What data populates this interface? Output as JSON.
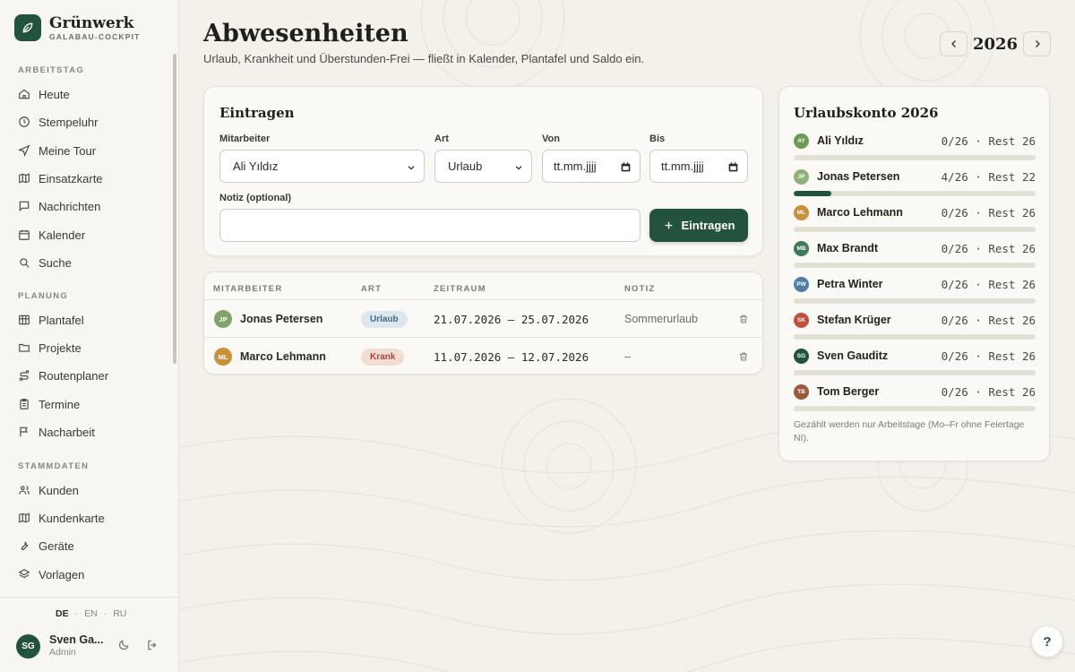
{
  "brand": {
    "name": "Grünwerk",
    "sub": "GALABAU-COCKPIT"
  },
  "sidebar": {
    "sections": [
      {
        "label": "ARBEITSTAG",
        "items": [
          {
            "label": "Heute",
            "icon": "home-icon"
          },
          {
            "label": "Stempeluhr",
            "icon": "clock-icon"
          },
          {
            "label": "Meine Tour",
            "icon": "navigation-icon"
          },
          {
            "label": "Einsatzkarte",
            "icon": "map-icon"
          },
          {
            "label": "Nachrichten",
            "icon": "message-icon"
          },
          {
            "label": "Kalender",
            "icon": "calendar-icon"
          },
          {
            "label": "Suche",
            "icon": "search-icon"
          }
        ]
      },
      {
        "label": "PLANUNG",
        "items": [
          {
            "label": "Plantafel",
            "icon": "grid-icon"
          },
          {
            "label": "Projekte",
            "icon": "folder-icon"
          },
          {
            "label": "Routenplaner",
            "icon": "route-icon"
          },
          {
            "label": "Termine",
            "icon": "clipboard-icon"
          },
          {
            "label": "Nacharbeit",
            "icon": "flag-icon"
          }
        ]
      },
      {
        "label": "STAMMDATEN",
        "items": [
          {
            "label": "Kunden",
            "icon": "users-icon"
          },
          {
            "label": "Kundenkarte",
            "icon": "map-icon"
          },
          {
            "label": "Geräte",
            "icon": "wrench-icon"
          },
          {
            "label": "Vorlagen",
            "icon": "layers-icon"
          }
        ]
      }
    ],
    "languages": [
      "DE",
      "EN",
      "RU"
    ],
    "active_language": "DE",
    "user": {
      "initials": "SG",
      "name": "Sven Ga...",
      "role": "Admin"
    }
  },
  "header": {
    "title": "Abwesenheiten",
    "subtitle": "Urlaub, Krankheit und Überstunden-Frei — fließt in Kalender, Plantafel und Saldo ein.",
    "year": "2026"
  },
  "form": {
    "title": "Eintragen",
    "employee_label": "Mitarbeiter",
    "employee_value": "Ali Yıldız",
    "type_label": "Art",
    "type_value": "Urlaub",
    "from_label": "Von",
    "from_placeholder": "tt.mm.jjjj",
    "to_label": "Bis",
    "to_placeholder": "tt.mm.jjjj",
    "note_label": "Notiz (optional)",
    "note_value": "",
    "submit_label": "Eintragen"
  },
  "table": {
    "headers": [
      "MITARBEITER",
      "ART",
      "ZEITRAUM",
      "NOTIZ"
    ],
    "rows": [
      {
        "initials": "JP",
        "name": "Jonas Petersen",
        "type": "Urlaub",
        "period": "21.07.2026 – 25.07.2026",
        "note": "Sommerurlaub",
        "avatar_color": "#7fa36a",
        "badge_bg": "#dce7ee",
        "badge_fg": "#3f6a86"
      },
      {
        "initials": "ML",
        "name": "Marco Lehmann",
        "type": "Krank",
        "period": "11.07.2026 – 12.07.2026",
        "note": "–",
        "avatar_color": "#c9913a",
        "badge_bg": "#f3dcd3",
        "badge_fg": "#a04a34"
      }
    ]
  },
  "account": {
    "title": "Urlaubskonto 2026",
    "rows": [
      {
        "initials": "AY",
        "name": "Ali Yıldız",
        "value": "0/26 · Rest 26",
        "taken": 0,
        "total": 26,
        "color": "#6f9a55"
      },
      {
        "initials": "JP",
        "name": "Jonas Petersen",
        "value": "4/26 · Rest 22",
        "taken": 4,
        "total": 26,
        "color": "#8fb07a"
      },
      {
        "initials": "ML",
        "name": "Marco Lehmann",
        "value": "0/26 · Rest 26",
        "taken": 0,
        "total": 26,
        "color": "#c9913a"
      },
      {
        "initials": "MB",
        "name": "Max Brandt",
        "value": "0/26 · Rest 26",
        "taken": 0,
        "total": 26,
        "color": "#3f7a57"
      },
      {
        "initials": "PW",
        "name": "Petra Winter",
        "value": "0/26 · Rest 26",
        "taken": 0,
        "total": 26,
        "color": "#4f7fa6"
      },
      {
        "initials": "SK",
        "name": "Stefan Krüger",
        "value": "0/26 · Rest 26",
        "taken": 0,
        "total": 26,
        "color": "#c0503e"
      },
      {
        "initials": "SG",
        "name": "Sven Gauditz",
        "value": "0/26 · Rest 26",
        "taken": 0,
        "total": 26,
        "color": "#24533d"
      },
      {
        "initials": "TB",
        "name": "Tom Berger",
        "value": "0/26 · Rest 26",
        "taken": 0,
        "total": 26,
        "color": "#9a5a3c"
      }
    ],
    "footnote": "Gezählt werden nur Arbeitstage (Mo–Fr ohne Feiertage NI)."
  },
  "help_label": "?",
  "colors": {
    "accent": "#24533d",
    "background": "#f3f1ea"
  }
}
